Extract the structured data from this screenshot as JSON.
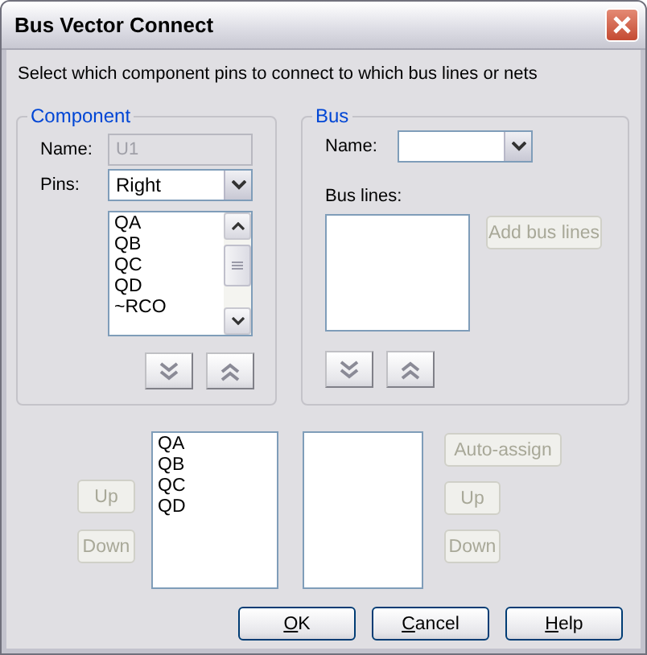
{
  "window": {
    "title": "Bus Vector Connect"
  },
  "instruction": "Select which component pins to connect to which bus lines or nets",
  "component": {
    "legend": "Component",
    "name_label": "Name:",
    "name_value": "U1",
    "name_disabled": true,
    "pins_label": "Pins:",
    "pins_value": "Right",
    "pins": [
      {
        "label": "QA"
      },
      {
        "label": "QB"
      },
      {
        "label": "QC"
      },
      {
        "label": "QD"
      },
      {
        "label": "~RCO"
      }
    ]
  },
  "bus": {
    "legend": "Bus",
    "name_label": "Name:",
    "bus_lines_label": "Bus lines:",
    "add_button": {
      "label": "Add bus lines",
      "disabled": true
    }
  },
  "left_buttons": [
    {
      "label": "Up",
      "disabled": true
    },
    {
      "label": "Down",
      "disabled": true
    }
  ],
  "pin_order": [
    {
      "label": "QA"
    },
    {
      "label": "QB"
    },
    {
      "label": "QC"
    },
    {
      "label": "QD"
    }
  ],
  "right_buttons": [
    {
      "label": "Auto-assign",
      "disabled": true
    },
    {
      "label": "Up",
      "disabled": true
    },
    {
      "label": "Down",
      "disabled": true
    }
  ],
  "dialog_buttons": [
    {
      "parts": [
        {
          "text": "O",
          "underline": true
        },
        {
          "text": "K",
          "underline": false
        }
      ],
      "disabled": false
    },
    {
      "parts": [
        {
          "text": "C",
          "underline": true
        },
        {
          "text": "ancel",
          "underline": false
        }
      ],
      "disabled": false
    },
    {
      "parts": [
        {
          "text": "H",
          "underline": true
        },
        {
          "text": "elp",
          "underline": false
        }
      ],
      "disabled": false
    }
  ]
}
